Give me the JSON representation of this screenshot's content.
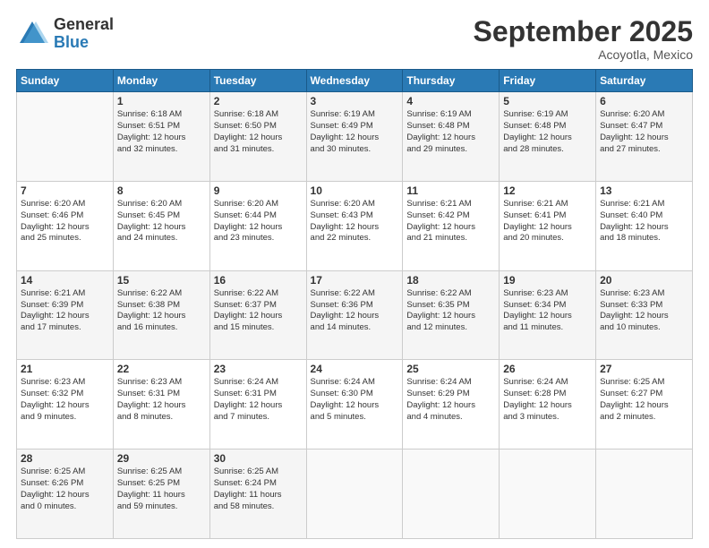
{
  "logo": {
    "general": "General",
    "blue": "Blue"
  },
  "header": {
    "month": "September 2025",
    "location": "Acoyotla, Mexico"
  },
  "weekdays": [
    "Sunday",
    "Monday",
    "Tuesday",
    "Wednesday",
    "Thursday",
    "Friday",
    "Saturday"
  ],
  "weeks": [
    [
      {
        "day": "",
        "info": ""
      },
      {
        "day": "1",
        "info": "Sunrise: 6:18 AM\nSunset: 6:51 PM\nDaylight: 12 hours\nand 32 minutes."
      },
      {
        "day": "2",
        "info": "Sunrise: 6:18 AM\nSunset: 6:50 PM\nDaylight: 12 hours\nand 31 minutes."
      },
      {
        "day": "3",
        "info": "Sunrise: 6:19 AM\nSunset: 6:49 PM\nDaylight: 12 hours\nand 30 minutes."
      },
      {
        "day": "4",
        "info": "Sunrise: 6:19 AM\nSunset: 6:48 PM\nDaylight: 12 hours\nand 29 minutes."
      },
      {
        "day": "5",
        "info": "Sunrise: 6:19 AM\nSunset: 6:48 PM\nDaylight: 12 hours\nand 28 minutes."
      },
      {
        "day": "6",
        "info": "Sunrise: 6:20 AM\nSunset: 6:47 PM\nDaylight: 12 hours\nand 27 minutes."
      }
    ],
    [
      {
        "day": "7",
        "info": "Sunrise: 6:20 AM\nSunset: 6:46 PM\nDaylight: 12 hours\nand 25 minutes."
      },
      {
        "day": "8",
        "info": "Sunrise: 6:20 AM\nSunset: 6:45 PM\nDaylight: 12 hours\nand 24 minutes."
      },
      {
        "day": "9",
        "info": "Sunrise: 6:20 AM\nSunset: 6:44 PM\nDaylight: 12 hours\nand 23 minutes."
      },
      {
        "day": "10",
        "info": "Sunrise: 6:20 AM\nSunset: 6:43 PM\nDaylight: 12 hours\nand 22 minutes."
      },
      {
        "day": "11",
        "info": "Sunrise: 6:21 AM\nSunset: 6:42 PM\nDaylight: 12 hours\nand 21 minutes."
      },
      {
        "day": "12",
        "info": "Sunrise: 6:21 AM\nSunset: 6:41 PM\nDaylight: 12 hours\nand 20 minutes."
      },
      {
        "day": "13",
        "info": "Sunrise: 6:21 AM\nSunset: 6:40 PM\nDaylight: 12 hours\nand 18 minutes."
      }
    ],
    [
      {
        "day": "14",
        "info": "Sunrise: 6:21 AM\nSunset: 6:39 PM\nDaylight: 12 hours\nand 17 minutes."
      },
      {
        "day": "15",
        "info": "Sunrise: 6:22 AM\nSunset: 6:38 PM\nDaylight: 12 hours\nand 16 minutes."
      },
      {
        "day": "16",
        "info": "Sunrise: 6:22 AM\nSunset: 6:37 PM\nDaylight: 12 hours\nand 15 minutes."
      },
      {
        "day": "17",
        "info": "Sunrise: 6:22 AM\nSunset: 6:36 PM\nDaylight: 12 hours\nand 14 minutes."
      },
      {
        "day": "18",
        "info": "Sunrise: 6:22 AM\nSunset: 6:35 PM\nDaylight: 12 hours\nand 12 minutes."
      },
      {
        "day": "19",
        "info": "Sunrise: 6:23 AM\nSunset: 6:34 PM\nDaylight: 12 hours\nand 11 minutes."
      },
      {
        "day": "20",
        "info": "Sunrise: 6:23 AM\nSunset: 6:33 PM\nDaylight: 12 hours\nand 10 minutes."
      }
    ],
    [
      {
        "day": "21",
        "info": "Sunrise: 6:23 AM\nSunset: 6:32 PM\nDaylight: 12 hours\nand 9 minutes."
      },
      {
        "day": "22",
        "info": "Sunrise: 6:23 AM\nSunset: 6:31 PM\nDaylight: 12 hours\nand 8 minutes."
      },
      {
        "day": "23",
        "info": "Sunrise: 6:24 AM\nSunset: 6:31 PM\nDaylight: 12 hours\nand 7 minutes."
      },
      {
        "day": "24",
        "info": "Sunrise: 6:24 AM\nSunset: 6:30 PM\nDaylight: 12 hours\nand 5 minutes."
      },
      {
        "day": "25",
        "info": "Sunrise: 6:24 AM\nSunset: 6:29 PM\nDaylight: 12 hours\nand 4 minutes."
      },
      {
        "day": "26",
        "info": "Sunrise: 6:24 AM\nSunset: 6:28 PM\nDaylight: 12 hours\nand 3 minutes."
      },
      {
        "day": "27",
        "info": "Sunrise: 6:25 AM\nSunset: 6:27 PM\nDaylight: 12 hours\nand 2 minutes."
      }
    ],
    [
      {
        "day": "28",
        "info": "Sunrise: 6:25 AM\nSunset: 6:26 PM\nDaylight: 12 hours\nand 0 minutes."
      },
      {
        "day": "29",
        "info": "Sunrise: 6:25 AM\nSunset: 6:25 PM\nDaylight: 11 hours\nand 59 minutes."
      },
      {
        "day": "30",
        "info": "Sunrise: 6:25 AM\nSunset: 6:24 PM\nDaylight: 11 hours\nand 58 minutes."
      },
      {
        "day": "",
        "info": ""
      },
      {
        "day": "",
        "info": ""
      },
      {
        "day": "",
        "info": ""
      },
      {
        "day": "",
        "info": ""
      }
    ]
  ]
}
